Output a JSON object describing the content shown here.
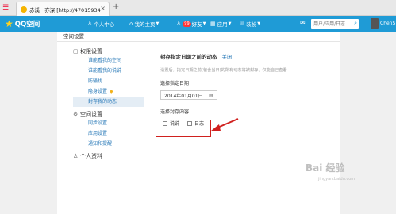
{
  "browser": {
    "menu_icon": "sogou-menu-icon",
    "tab_title": "赤溪 · 亦深 [http://470159343]",
    "tab_close": "×",
    "new_tab": "+"
  },
  "qq": {
    "logo_text": "QQ空间",
    "nav": [
      {
        "label": "个人中心",
        "icon": "person-icon"
      },
      {
        "label": "我的主页",
        "icon": "home-icon"
      },
      {
        "label": "好友",
        "icon": "friends-icon",
        "badge": "99"
      },
      {
        "label": "应用",
        "icon": "grid-icon"
      },
      {
        "label": "装扮",
        "icon": "dress-icon"
      }
    ],
    "search_placeholder": "用户/应用/日志",
    "user_name": "ChenS"
  },
  "page": {
    "title": "空间设置",
    "sidebar": {
      "sections": [
        {
          "title": "权限设置",
          "icon": "lock-icon",
          "items": [
            "谁能看我的空间",
            "谁能看我的说说",
            "防骚扰",
            "隐身设置",
            "封存我的动态"
          ]
        },
        {
          "title": "空间设置",
          "icon": "gear-icon",
          "items": [
            "同步设置",
            "应用设置",
            "通知和提醒"
          ]
        },
        {
          "title": "个人资料",
          "icon": "person-icon",
          "items": []
        }
      ]
    },
    "main": {
      "heading": "封存指定日期之前的动态",
      "close_link": "关闭",
      "description": "设置后，指定日期之前(包含当日)的所有动态将被封存，仅能自己查看",
      "date_label": "选择指定日期：",
      "date_value": "2014年01月01日",
      "content_label": "选择封存内容：",
      "options": [
        {
          "label": "说说",
          "checked": false
        },
        {
          "label": "日志",
          "checked": false
        }
      ]
    }
  },
  "watermark": {
    "text": "Bai 经验",
    "sub": "jingyan.baidu.com"
  },
  "colors": {
    "qq_bar": "#1f9bd6",
    "link": "#2a7ab8",
    "highlight_box": "#d0201e",
    "active_item_bg": "#e4edf5"
  }
}
